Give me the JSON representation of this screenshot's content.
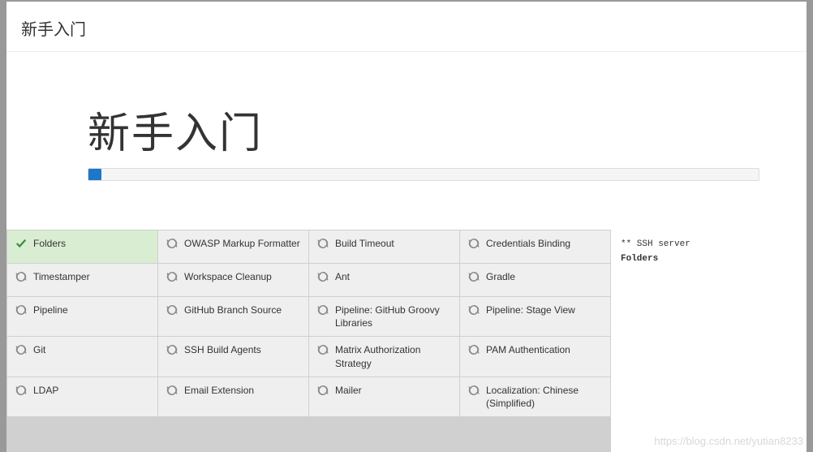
{
  "window_title": "新手入门",
  "hero": {
    "title": "新手入门",
    "progress_percent": 2
  },
  "plugins": [
    {
      "label": "Folders",
      "status": "success"
    },
    {
      "label": "OWASP Markup Formatter",
      "status": "loading"
    },
    {
      "label": "Build Timeout",
      "status": "loading"
    },
    {
      "label": "Credentials Binding",
      "status": "loading"
    },
    {
      "label": "Timestamper",
      "status": "loading"
    },
    {
      "label": "Workspace Cleanup",
      "status": "loading"
    },
    {
      "label": "Ant",
      "status": "loading"
    },
    {
      "label": "Gradle",
      "status": "loading"
    },
    {
      "label": "Pipeline",
      "status": "loading"
    },
    {
      "label": "GitHub Branch Source",
      "status": "loading"
    },
    {
      "label": "Pipeline: GitHub Groovy Libraries",
      "status": "loading"
    },
    {
      "label": "Pipeline: Stage View",
      "status": "loading"
    },
    {
      "label": "Git",
      "status": "loading"
    },
    {
      "label": "SSH Build Agents",
      "status": "loading"
    },
    {
      "label": "Matrix Authorization Strategy",
      "status": "loading"
    },
    {
      "label": "PAM Authentication",
      "status": "loading"
    },
    {
      "label": "LDAP",
      "status": "loading"
    },
    {
      "label": "Email Extension",
      "status": "loading"
    },
    {
      "label": "Mailer",
      "status": "loading"
    },
    {
      "label": "Localization: Chinese (Simplified)",
      "status": "loading"
    }
  ],
  "log": {
    "line1": "** SSH server",
    "line2": "Folders"
  },
  "watermark": "https://blog.csdn.net/yutian8233"
}
